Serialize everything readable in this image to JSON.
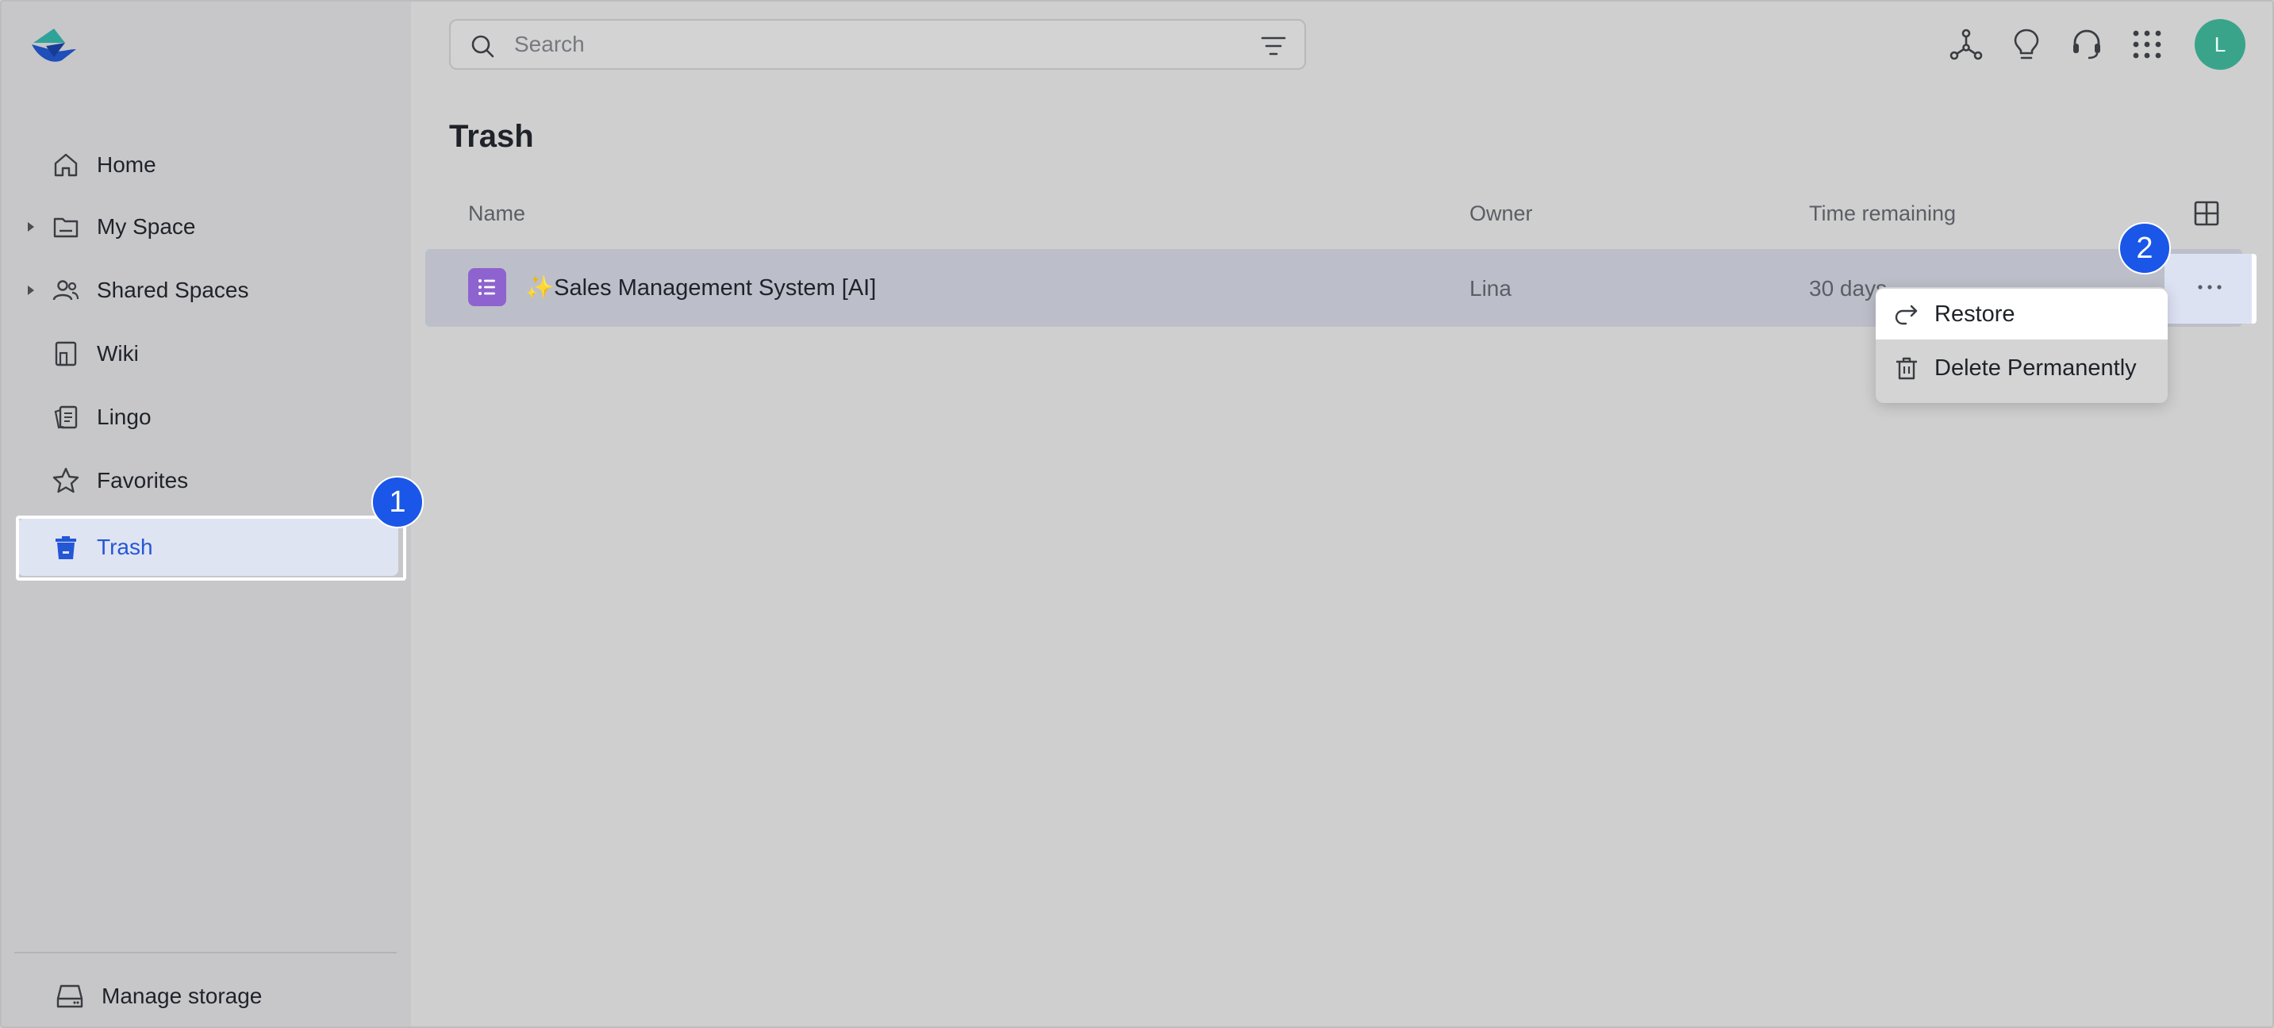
{
  "sidebar": {
    "items": [
      {
        "label": "Home",
        "icon": "home-icon",
        "has_caret": false,
        "active": false
      },
      {
        "label": "My Space",
        "icon": "folder-icon",
        "has_caret": true,
        "active": false
      },
      {
        "label": "Shared Spaces",
        "icon": "users-icon",
        "has_caret": true,
        "active": false
      },
      {
        "label": "Wiki",
        "icon": "wiki-icon",
        "has_caret": false,
        "active": false
      },
      {
        "label": "Lingo",
        "icon": "lingo-icon",
        "has_caret": false,
        "active": false
      },
      {
        "label": "Favorites",
        "icon": "star-icon",
        "has_caret": false,
        "active": false
      },
      {
        "label": "Trash",
        "icon": "trash-icon",
        "has_caret": false,
        "active": true
      }
    ],
    "manage_storage": "Manage storage"
  },
  "badges": {
    "one": "1",
    "two": "2"
  },
  "header": {
    "search_placeholder": "Search",
    "avatar_initial": "L"
  },
  "main": {
    "title": "Trash",
    "columns": {
      "name": "Name",
      "owner": "Owner",
      "time": "Time remaining"
    },
    "rows": [
      {
        "name": "✨Sales Management System [AI]",
        "owner": "Lina",
        "time": "30 days"
      }
    ]
  },
  "context_menu": {
    "restore": "Restore",
    "delete": "Delete Permanently"
  },
  "colors": {
    "accent": "#2457d6",
    "badge": "#1a56e8",
    "avatar": "#3aa48a",
    "file_icon": "#8e63cf"
  }
}
